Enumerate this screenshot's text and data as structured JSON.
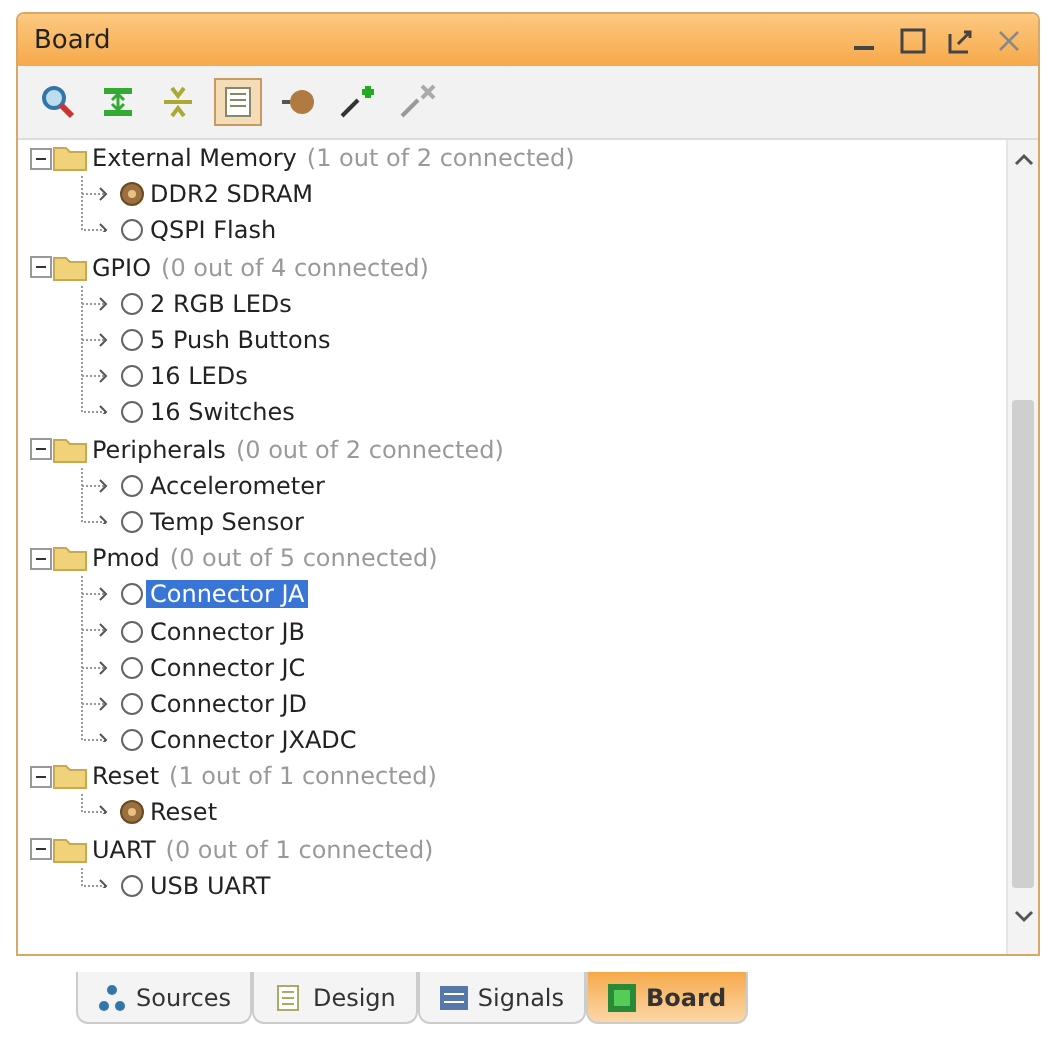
{
  "window": {
    "title": "Board"
  },
  "toolbar": [
    {
      "kind": "search",
      "pressed": false
    },
    {
      "kind": "expand-all",
      "pressed": false
    },
    {
      "kind": "collapse-all",
      "pressed": false
    },
    {
      "kind": "toggle-view",
      "pressed": true
    },
    {
      "kind": "auto-connect",
      "pressed": false
    },
    {
      "kind": "connect",
      "pressed": false
    },
    {
      "kind": "disconnect",
      "pressed": false
    }
  ],
  "tree": [
    {
      "label": "External Memory",
      "summary": "(1 out of 2 connected)",
      "expanded": true,
      "children": [
        {
          "label": "DDR2 SDRAM",
          "connected": true,
          "selected": false
        },
        {
          "label": "QSPI Flash",
          "connected": false,
          "selected": false
        }
      ]
    },
    {
      "label": "GPIO",
      "summary": "(0 out of 4 connected)",
      "expanded": true,
      "children": [
        {
          "label": "2 RGB LEDs",
          "connected": false,
          "selected": false
        },
        {
          "label": "5 Push Buttons",
          "connected": false,
          "selected": false
        },
        {
          "label": "16 LEDs",
          "connected": false,
          "selected": false
        },
        {
          "label": "16 Switches",
          "connected": false,
          "selected": false
        }
      ]
    },
    {
      "label": "Peripherals",
      "summary": "(0 out of 2 connected)",
      "expanded": true,
      "children": [
        {
          "label": "Accelerometer",
          "connected": false,
          "selected": false
        },
        {
          "label": "Temp Sensor",
          "connected": false,
          "selected": false
        }
      ]
    },
    {
      "label": "Pmod",
      "summary": "(0 out of 5 connected)",
      "expanded": true,
      "children": [
        {
          "label": "Connector JA",
          "connected": false,
          "selected": true
        },
        {
          "label": "Connector JB",
          "connected": false,
          "selected": false
        },
        {
          "label": "Connector JC",
          "connected": false,
          "selected": false
        },
        {
          "label": "Connector JD",
          "connected": false,
          "selected": false
        },
        {
          "label": "Connector JXADC",
          "connected": false,
          "selected": false
        }
      ]
    },
    {
      "label": "Reset",
      "summary": "(1 out of 1 connected)",
      "expanded": true,
      "children": [
        {
          "label": "Reset",
          "connected": true,
          "selected": false
        }
      ]
    },
    {
      "label": "UART",
      "summary": "(0 out of 1 connected)",
      "expanded": true,
      "children": [
        {
          "label": "USB UART",
          "connected": false,
          "selected": false
        }
      ]
    }
  ],
  "tabs": [
    {
      "label": "Sources",
      "kind": "sources",
      "selected": false
    },
    {
      "label": "Design",
      "kind": "design",
      "selected": false
    },
    {
      "label": "Signals",
      "kind": "signals",
      "selected": false
    },
    {
      "label": "Board",
      "kind": "board",
      "selected": true
    }
  ]
}
